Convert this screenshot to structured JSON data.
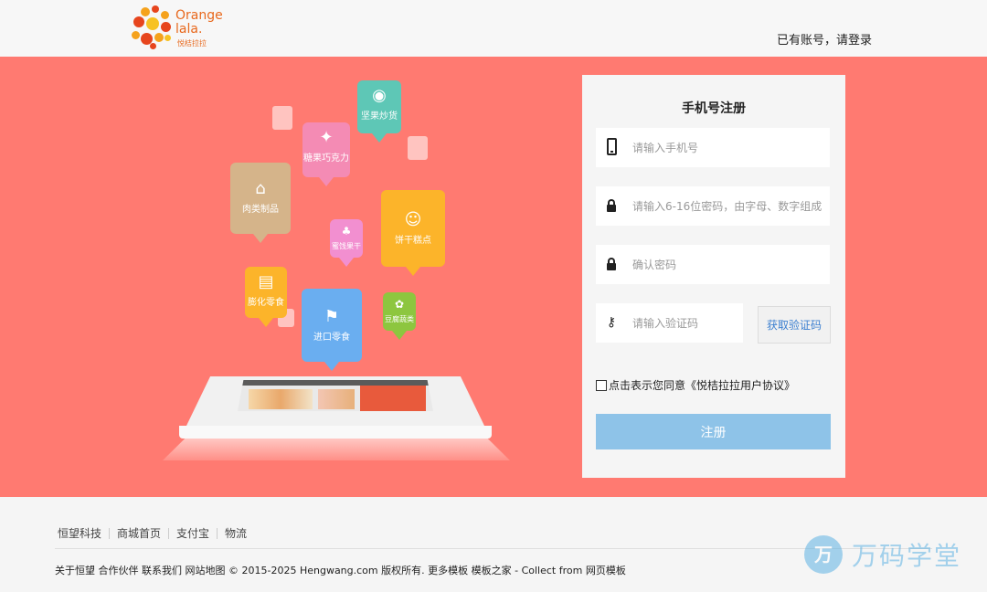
{
  "header": {
    "logo_text_line1": "Orange",
    "logo_text_line2": "lala.",
    "logo_subtitle": "悦桔拉拉",
    "login_link": "已有账号，请登录"
  },
  "illustration": {
    "bubbles": [
      {
        "label": "坚果炒货",
        "icon": "nut-icon",
        "color": "#5ec7b6"
      },
      {
        "label": "糖果巧克力",
        "icon": "candy-icon",
        "color": "#f48bb4"
      },
      {
        "label": "肉类制品",
        "icon": "drumstick-icon",
        "color": "#d5b48a"
      },
      {
        "label": "蜜饯果干",
        "icon": "cherry-icon",
        "color": "#f28fd0"
      },
      {
        "label": "饼干糕点",
        "icon": "cookie-icon",
        "color": "#fcb42a"
      },
      {
        "label": "膨化零食",
        "icon": "snack-icon",
        "color": "#fcb42a"
      },
      {
        "label": "进口零食",
        "icon": "flag-icon",
        "color": "#6aaef0"
      },
      {
        "label": "豆腐蔬类",
        "icon": "veggie-icon",
        "color": "#8dc63f"
      }
    ]
  },
  "register": {
    "title": "手机号注册",
    "phone_placeholder": "请输入手机号",
    "password_placeholder": "请输入6-16位密码，由字母、数字组成",
    "confirm_placeholder": "确认密码",
    "code_placeholder": "请输入验证码",
    "get_code_button": "获取验证码",
    "agreement": "点击表示您同意《悦桔拉拉用户协议》",
    "submit_button": "注册"
  },
  "footer": {
    "links": [
      "恒望科技",
      "商城首页",
      "支付宝",
      "物流"
    ],
    "bottom_links": [
      "关于恒望",
      "合作伙伴",
      "联系我们",
      "网站地图"
    ],
    "copyright": "© 2015-2025 Hengwang.com 版权所有.",
    "more_templates_prefix": "更多模板",
    "more_templates_link": "模板之家",
    "collect_prefix": "- Collect from",
    "collect_link": "网页模板",
    "watermark_glyph": "万",
    "watermark_text": "万码学堂"
  },
  "colors": {
    "banner": "#ff7a71",
    "submit": "#8ec3e8",
    "code_button_text": "#3b7fd0",
    "logo": "#e8681c"
  }
}
